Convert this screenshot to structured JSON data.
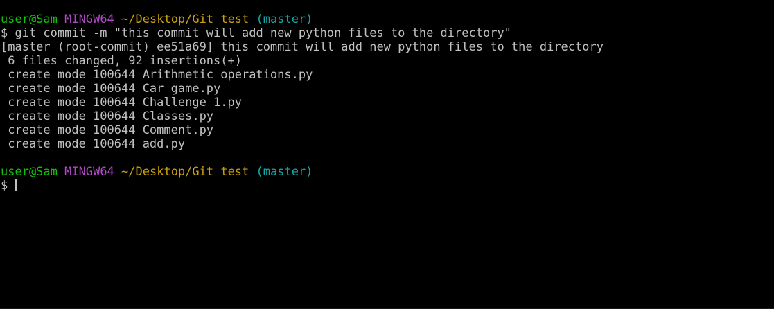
{
  "terminal": {
    "prompt1": {
      "user": "user@Sam",
      "host": "MINGW64",
      "path": "~/Desktop/Git test",
      "branch": "(master)"
    },
    "command_line": "$ git commit -m \"this commit will add new python files to the directory\"",
    "output": [
      "[master (root-commit) ee51a69] this commit will add new python files to the directory",
      " 6 files changed, 92 insertions(+)",
      " create mode 100644 Arithmetic operations.py",
      " create mode 100644 Car game.py",
      " create mode 100644 Challenge 1.py",
      " create mode 100644 Classes.py",
      " create mode 100644 Comment.py",
      " create mode 100644 add.py"
    ],
    "prompt2": {
      "user": "user@Sam",
      "host": "MINGW64",
      "path": "~/Desktop/Git test",
      "branch": "(master)"
    },
    "input_prompt": "$ ",
    "colors": {
      "background": "#000000",
      "text": "#c0c0c0",
      "user": "#13c20d",
      "host": "#b148c6",
      "path": "#c9a00c",
      "branch": "#13a8a8"
    }
  }
}
